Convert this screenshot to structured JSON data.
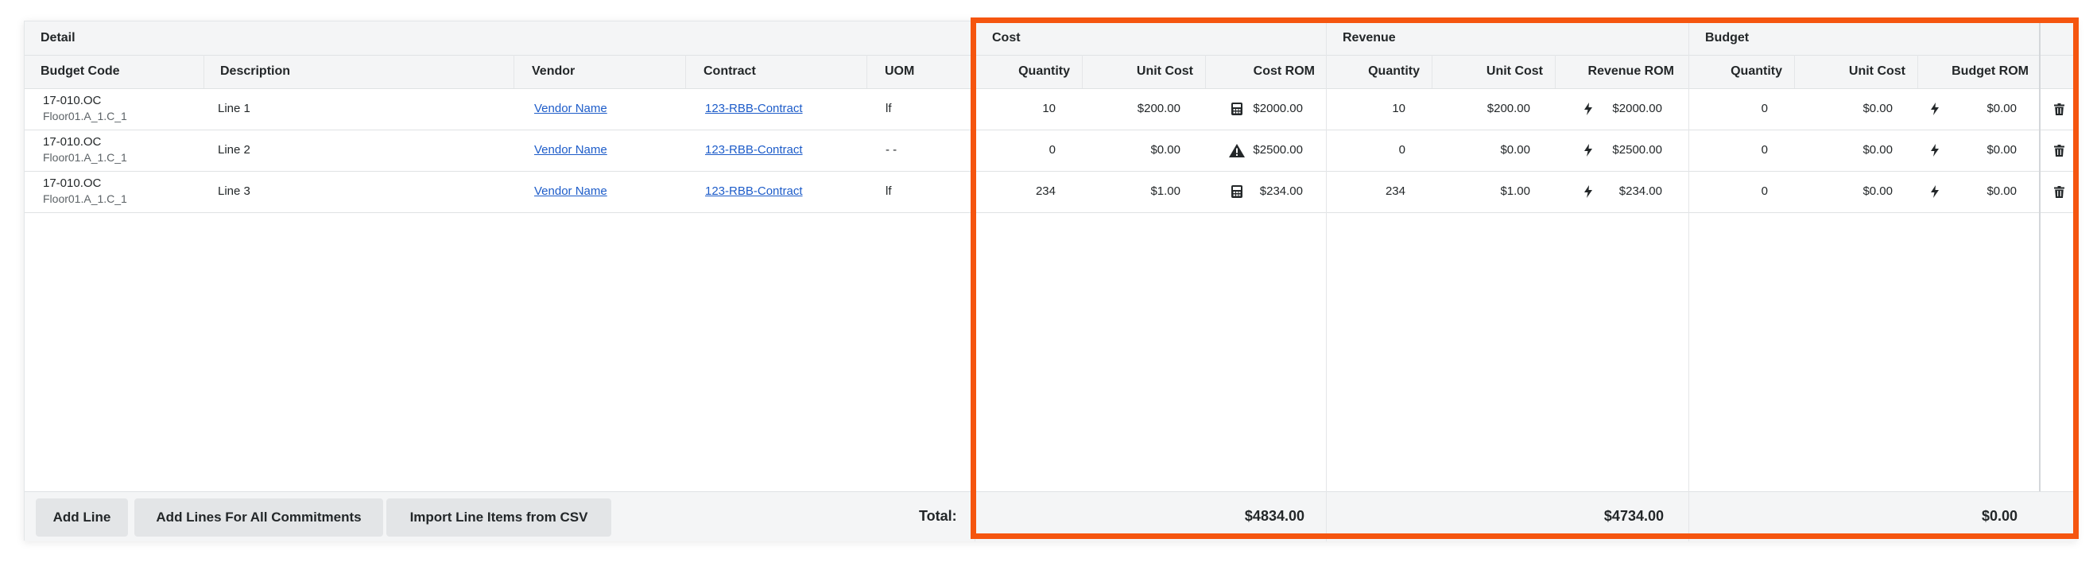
{
  "groups": {
    "detail": "Detail",
    "cost": "Cost",
    "revenue": "Revenue",
    "budget": "Budget"
  },
  "columns": {
    "budget_code": "Budget Code",
    "description": "Description",
    "vendor": "Vendor",
    "contract": "Contract",
    "uom": "UOM",
    "cost_quantity": "Quantity",
    "cost_unit_cost": "Unit Cost",
    "cost_rom": "Cost ROM",
    "revenue_quantity": "Quantity",
    "revenue_unit_cost": "Unit Cost",
    "revenue_rom": "Revenue ROM",
    "budget_quantity": "Quantity",
    "budget_unit_cost": "Unit Cost",
    "budget_rom": "Budget ROM"
  },
  "rows": [
    {
      "budget_code": "17-010.OC",
      "location": "Floor01.A_1.C_1",
      "description": "Line 1",
      "vendor": "Vendor Name",
      "contract": "123-RBB-Contract",
      "uom": "lf",
      "cost_quantity": "10",
      "cost_unit_cost": "$200.00",
      "cost_rom_icon": "calculator-icon",
      "cost_rom": "$2000.00",
      "revenue_quantity": "10",
      "revenue_unit_cost": "$200.00",
      "revenue_rom_icon": "lightning-icon",
      "revenue_rom": "$2000.00",
      "budget_quantity": "0",
      "budget_unit_cost": "$0.00",
      "budget_rom_icon": "lightning-icon",
      "budget_rom": "$0.00"
    },
    {
      "budget_code": "17-010.OC",
      "location": "Floor01.A_1.C_1",
      "description": "Line 2",
      "vendor": "Vendor Name",
      "contract": "123-RBB-Contract",
      "uom": "- -",
      "cost_quantity": "0",
      "cost_unit_cost": "$0.00",
      "cost_rom_icon": "warning-icon",
      "cost_rom": "$2500.00",
      "revenue_quantity": "0",
      "revenue_unit_cost": "$0.00",
      "revenue_rom_icon": "lightning-icon",
      "revenue_rom": "$2500.00",
      "budget_quantity": "0",
      "budget_unit_cost": "$0.00",
      "budget_rom_icon": "lightning-icon",
      "budget_rom": "$0.00"
    },
    {
      "budget_code": "17-010.OC",
      "location": "Floor01.A_1.C_1",
      "description": "Line 3",
      "vendor": "Vendor Name",
      "contract": "123-RBB-Contract",
      "uom": "lf",
      "cost_quantity": "234",
      "cost_unit_cost": "$1.00",
      "cost_rom_icon": "calculator-icon",
      "cost_rom": "$234.00",
      "revenue_quantity": "234",
      "revenue_unit_cost": "$1.00",
      "revenue_rom_icon": "lightning-icon",
      "revenue_rom": "$234.00",
      "budget_quantity": "0",
      "budget_unit_cost": "$0.00",
      "budget_rom_icon": "lightning-icon",
      "budget_rom": "$0.00"
    }
  ],
  "row_action_icon": "trash-icon",
  "footer": {
    "add_line": "Add Line",
    "add_lines_all": "Add Lines For All Commitments",
    "import_csv": "Import Line Items from CSV",
    "total_label": "Total:",
    "cost_total": "$4834.00",
    "revenue_total": "$4734.00",
    "budget_total": "$0.00"
  },
  "colors": {
    "highlight": "#f5550f",
    "link": "#1d5cc9",
    "header_band": "#f4f5f6",
    "button": "#e3e5e7"
  }
}
